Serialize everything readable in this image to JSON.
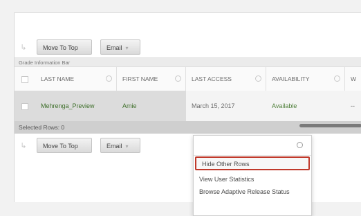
{
  "toolbar_top": {
    "move_to_top": "Move To Top",
    "email": "Email"
  },
  "toolbar_bottom": {
    "move_to_top": "Move To Top",
    "email": "Email"
  },
  "info_bar": "Grade Information Bar",
  "columns": [
    "LAST NAME",
    "FIRST NAME",
    "LAST ACCESS",
    "AVAILABILITY",
    "W"
  ],
  "row": {
    "last_name": "Mehrenga_Preview",
    "first_name": "Amie",
    "last_access": "March 15, 2017",
    "availability": "Available",
    "extra": "--"
  },
  "selected_rows": "Selected Rows: 0",
  "menu": {
    "items": [
      "Hide Other Rows",
      "View User Statistics",
      "Browse Adaptive Release Status"
    ]
  },
  "colors": {
    "highlight_border": "#c0392b",
    "link_green": "#3e6f2a"
  },
  "icons": {
    "row_arrow": "arrow-icon",
    "column_options": "circle-icon",
    "row_menu": "circle-icon",
    "menu_settings": "gear-icon"
  }
}
